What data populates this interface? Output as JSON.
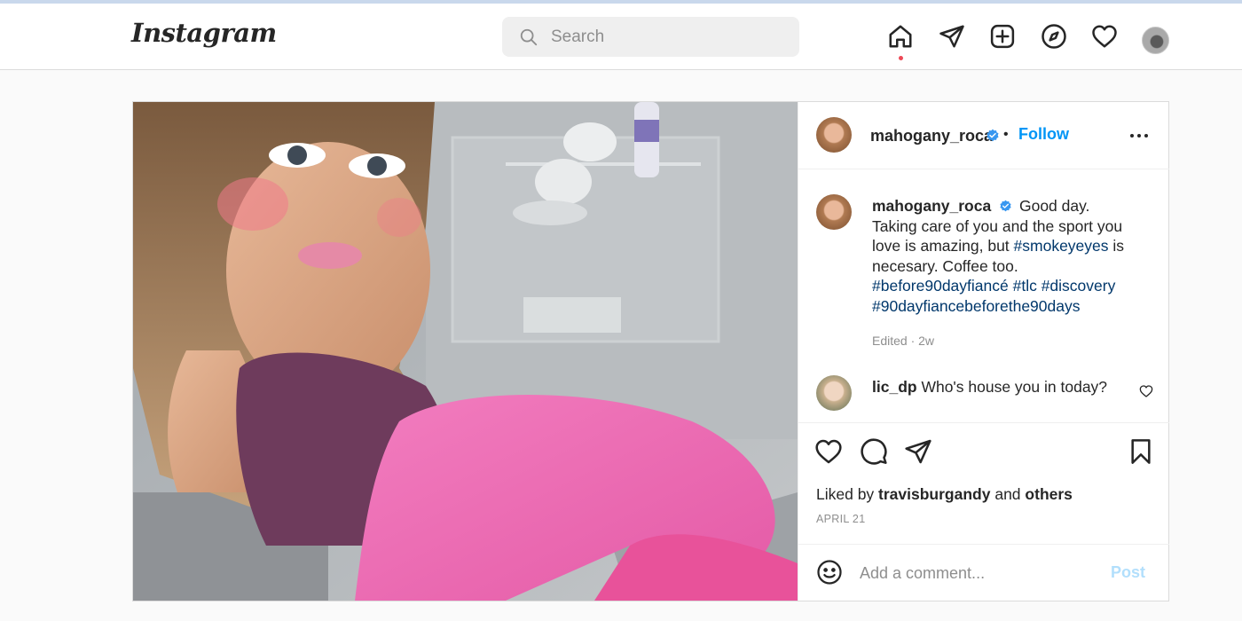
{
  "nav": {
    "logo": "Instagram",
    "search_placeholder": "Search",
    "icons": [
      "home-icon",
      "direct-icon",
      "new-post-icon",
      "explore-icon",
      "activity-icon",
      "profile-avatar"
    ]
  },
  "post": {
    "author": "mahogany_roca",
    "follow_label": "Follow",
    "bullet": "•",
    "caption": {
      "username": "mahogany_roca",
      "line1": "Good day.",
      "line2": "Taking care of you and the sport you",
      "line3_pre": "love is amazing, but ",
      "line3_tag": "#smokeyeyes",
      "line3_post": " is",
      "line4": "necesary. Coffee too.",
      "tags_line1": "#before90dayfiancé #tlc #discovery",
      "tags_line2": "#90dayfiancebeforethe90days"
    },
    "edited": "Edited · 2w",
    "comment": {
      "username": "lic_dp",
      "text": "Who's house you in today?"
    },
    "likes": {
      "prefix": "Liked by ",
      "user": "travisburgandy",
      "middle": " and ",
      "others": "others"
    },
    "date": "APRIL 21",
    "add_comment_placeholder": "Add a comment...",
    "post_label": "Post"
  },
  "colors": {
    "accent": "#0095f6",
    "hashtag": "#00376b",
    "muted": "#8e8e8e",
    "notification": "#ed4956"
  }
}
